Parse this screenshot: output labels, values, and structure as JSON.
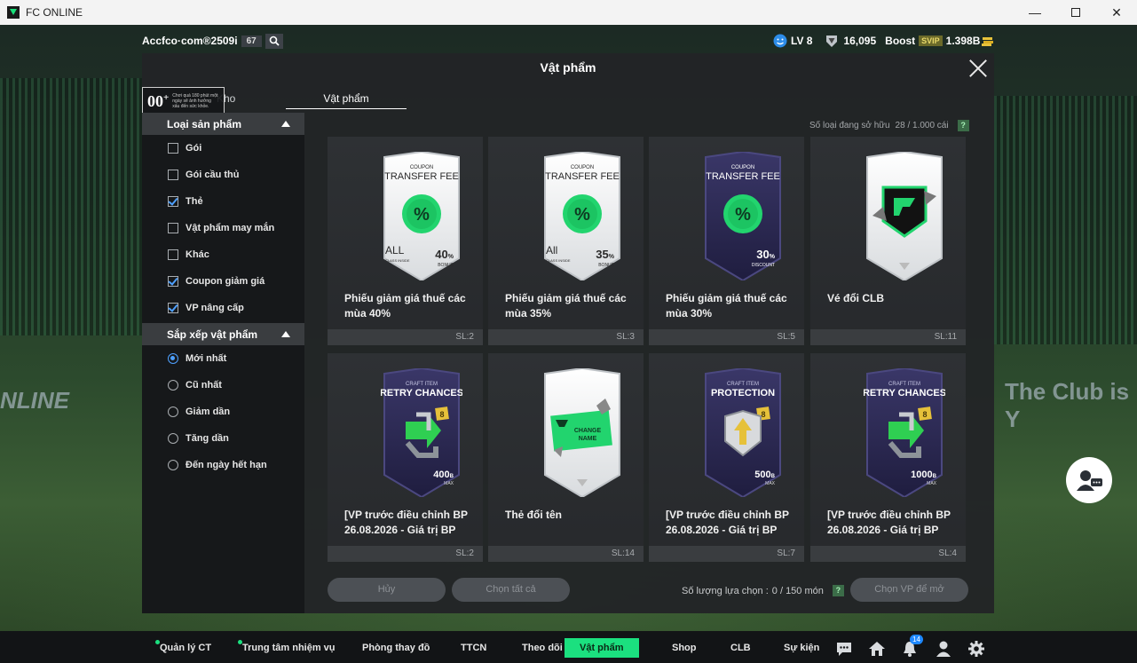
{
  "window": {
    "title": "FC ONLINE"
  },
  "hud": {
    "account": "Accfco·com®2509i",
    "account_num": "67",
    "level": "LV 8",
    "coins": "16,095",
    "boost_label": "Boost",
    "svip": "SVIP",
    "bp": "1.398B"
  },
  "background": {
    "adboard_left": "NLINE",
    "adboard_right": "The Club is Y"
  },
  "panel": {
    "title": "Vật phẩm",
    "tabs": [
      {
        "label": "Kho"
      },
      {
        "label": "Vật phẩm"
      }
    ],
    "age_rating": {
      "number": "00",
      "plus": "+",
      "text": "Chơi quá 180 phút một ngày sẽ ảnh hưởng xấu đến sức khỏe."
    },
    "owned_label": "Số loại đang sở hữu",
    "owned_value": "28 / 1.000 cái",
    "help": "?"
  },
  "sidebar": {
    "category_header": "Loại sản phẩm",
    "categories": [
      {
        "label": "Gói",
        "checked": false
      },
      {
        "label": "Gói cầu thủ",
        "checked": false
      },
      {
        "label": "Thẻ",
        "checked": true
      },
      {
        "label": "Vật phẩm may mắn",
        "checked": false
      },
      {
        "label": "Khác",
        "checked": false
      },
      {
        "label": "Coupon giảm giá",
        "checked": true
      },
      {
        "label": "VP nâng cấp",
        "checked": true
      }
    ],
    "sort_header": "Sắp xếp vật phẩm",
    "sorts": [
      {
        "label": "Mới nhất",
        "selected": true
      },
      {
        "label": "Cũ nhất",
        "selected": false
      },
      {
        "label": "Giảm dần",
        "selected": false
      },
      {
        "label": "Tăng dần",
        "selected": false
      },
      {
        "label": "Đến ngày hết hạn",
        "selected": false
      }
    ]
  },
  "items": [
    {
      "name": "Phiếu giảm giá thuế các mùa 40%",
      "qty": "SL:2",
      "kind": "coupon",
      "theme": "white",
      "top": "COUPON",
      "heading": "TRANSFER FEE",
      "corner": "ALL",
      "corner_sub": "CLASS INSIDE",
      "value": "40",
      "unit": "%",
      "sub": "BONUS"
    },
    {
      "name": "Phiếu giảm giá thuế các mùa 35%",
      "qty": "SL:3",
      "kind": "coupon",
      "theme": "white",
      "top": "COUPON",
      "heading": "TRANSFER FEE",
      "corner": "All",
      "corner_sub": "CLASS INSIDE",
      "value": "35",
      "unit": "%",
      "sub": "BONUS"
    },
    {
      "name": "Phiếu giảm giá thuế các mùa 30%",
      "qty": "SL:5",
      "kind": "coupon",
      "theme": "dark",
      "top": "COUPON",
      "heading": "TRANSFER FEE",
      "corner": "",
      "corner_sub": "",
      "value": "30",
      "unit": "%",
      "sub": "DISCOUNT"
    },
    {
      "name": "Vé đổi CLB",
      "qty": "SL:11",
      "kind": "club",
      "theme": "white"
    },
    {
      "name": "[VP trước điều chỉnh BP 26.08.2026 - Giá trị BP",
      "qty": "SL:2",
      "kind": "craft",
      "theme": "dark",
      "top": "CRAFT ITEM",
      "heading": "RETRY CHANCES",
      "level": "8",
      "value": "400",
      "unit": "B",
      "sub": "MAX"
    },
    {
      "name": "Thẻ đổi tên",
      "qty": "SL:14",
      "kind": "rename",
      "theme": "white",
      "label1": "CHANGE",
      "label2": "NAME"
    },
    {
      "name": "[VP trước điều chỉnh BP 26.08.2026 - Giá trị BP",
      "qty": "SL:7",
      "kind": "craft",
      "theme": "dark",
      "top": "CRAFT ITEM",
      "heading": "PROTECTION",
      "level": "8",
      "value": "500",
      "unit": "B",
      "sub": "MAX"
    },
    {
      "name": "[VP trước điều chỉnh BP 26.08.2026 - Giá trị BP",
      "qty": "SL:4",
      "kind": "craft",
      "theme": "dark",
      "top": "CRAFT ITEM",
      "heading": "RETRY CHANCES",
      "level": "8",
      "value": "1000",
      "unit": "B",
      "sub": "MAX"
    }
  ],
  "footer": {
    "cancel": "Hủy",
    "select_all": "Chọn tất cả",
    "selection_label": "Số lượng lựa chọn :",
    "selection_value": "0 / 150 món",
    "help": "?",
    "confirm": "Chọn VP để mở"
  },
  "nav": {
    "items": [
      {
        "label": "Quản lý CT",
        "dot": true
      },
      {
        "label": "Trung tâm nhiệm vụ",
        "dot": true
      },
      {
        "label": "Phòng thay đồ"
      },
      {
        "label": "TTCN"
      },
      {
        "label": "Theo dõi"
      },
      {
        "label": "Vật phẩm",
        "active": true
      },
      {
        "label": "Shop"
      },
      {
        "label": "CLB"
      },
      {
        "label": "Sự kiện"
      }
    ],
    "notif_count": "14"
  },
  "colors": {
    "accent": "#1be07f",
    "checkbox": "#4ea0ff",
    "panel": "#222426",
    "coupon_green": "#22d46e"
  }
}
